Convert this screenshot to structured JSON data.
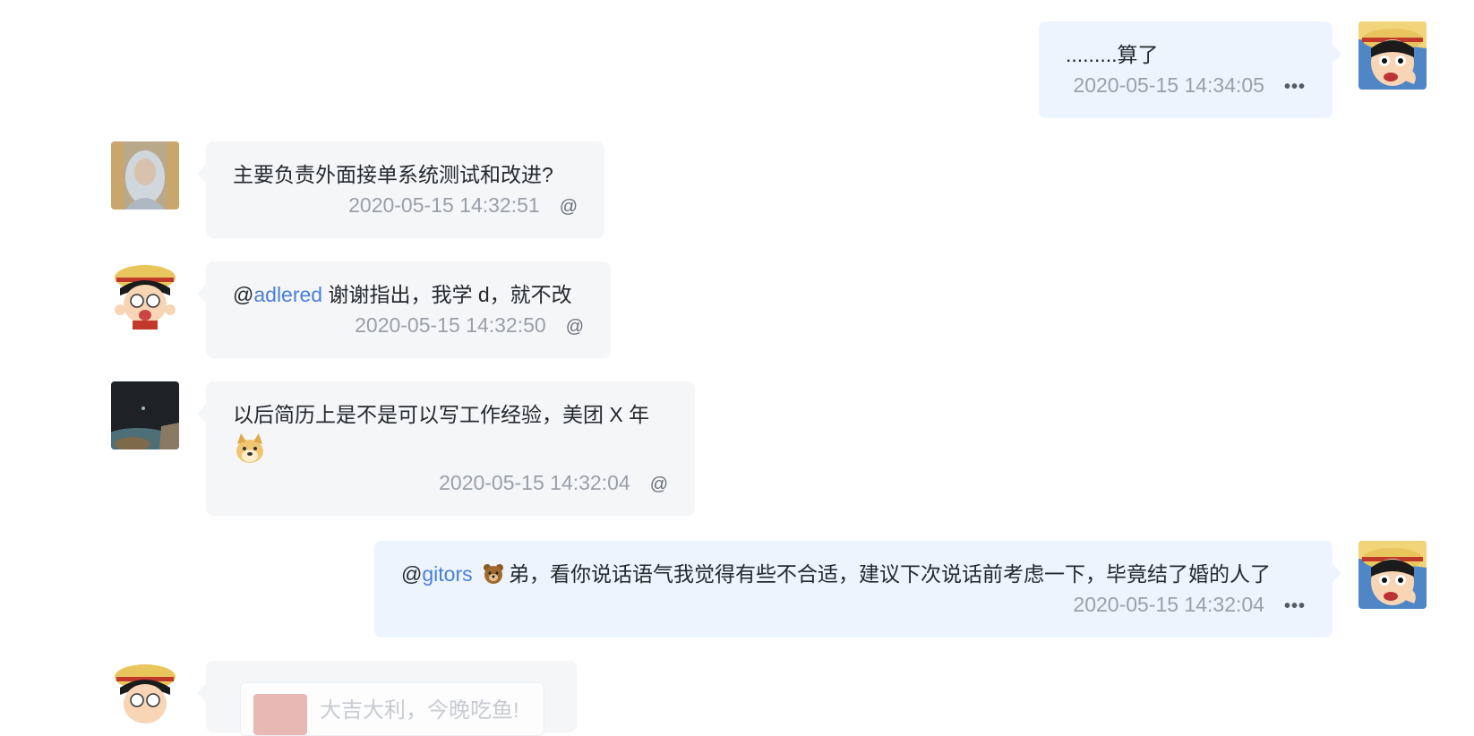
{
  "messages": [
    {
      "side": "right",
      "text": ".........算了",
      "time": "2020-05-15 14:34:05",
      "action": "•••"
    },
    {
      "side": "left",
      "text": "主要负责外面接单系统测试和改进?",
      "time": "2020-05-15 14:32:51",
      "action": "@"
    },
    {
      "side": "left",
      "mention": "adlered",
      "text": "谢谢指出，我学 d，就不改",
      "time": "2020-05-15 14:32:50",
      "action": "@"
    },
    {
      "side": "left",
      "text": "以后简历上是不是可以写工作经验，美团 X 年",
      "time": "2020-05-15 14:32:04",
      "action": "@",
      "emoji": "doge-emoji"
    },
    {
      "side": "right",
      "mention": "gitors",
      "text": "弟，看你说话语气我觉得有些不合适，建议下次说话前考虑一下，毕竟结了婚的人了",
      "time": "2020-05-15 14:32:04",
      "action": "•••",
      "emoji": "bear-emoji"
    },
    {
      "side": "left",
      "red_packet_text": "大吉大利，今晚吃鱼!"
    }
  ],
  "at_symbol": "@",
  "colors": {
    "left_bubble": "#f5f6f8",
    "right_bubble": "#edf4fd",
    "mention": "#4a7fd8",
    "meta": "#9aa0a8"
  }
}
